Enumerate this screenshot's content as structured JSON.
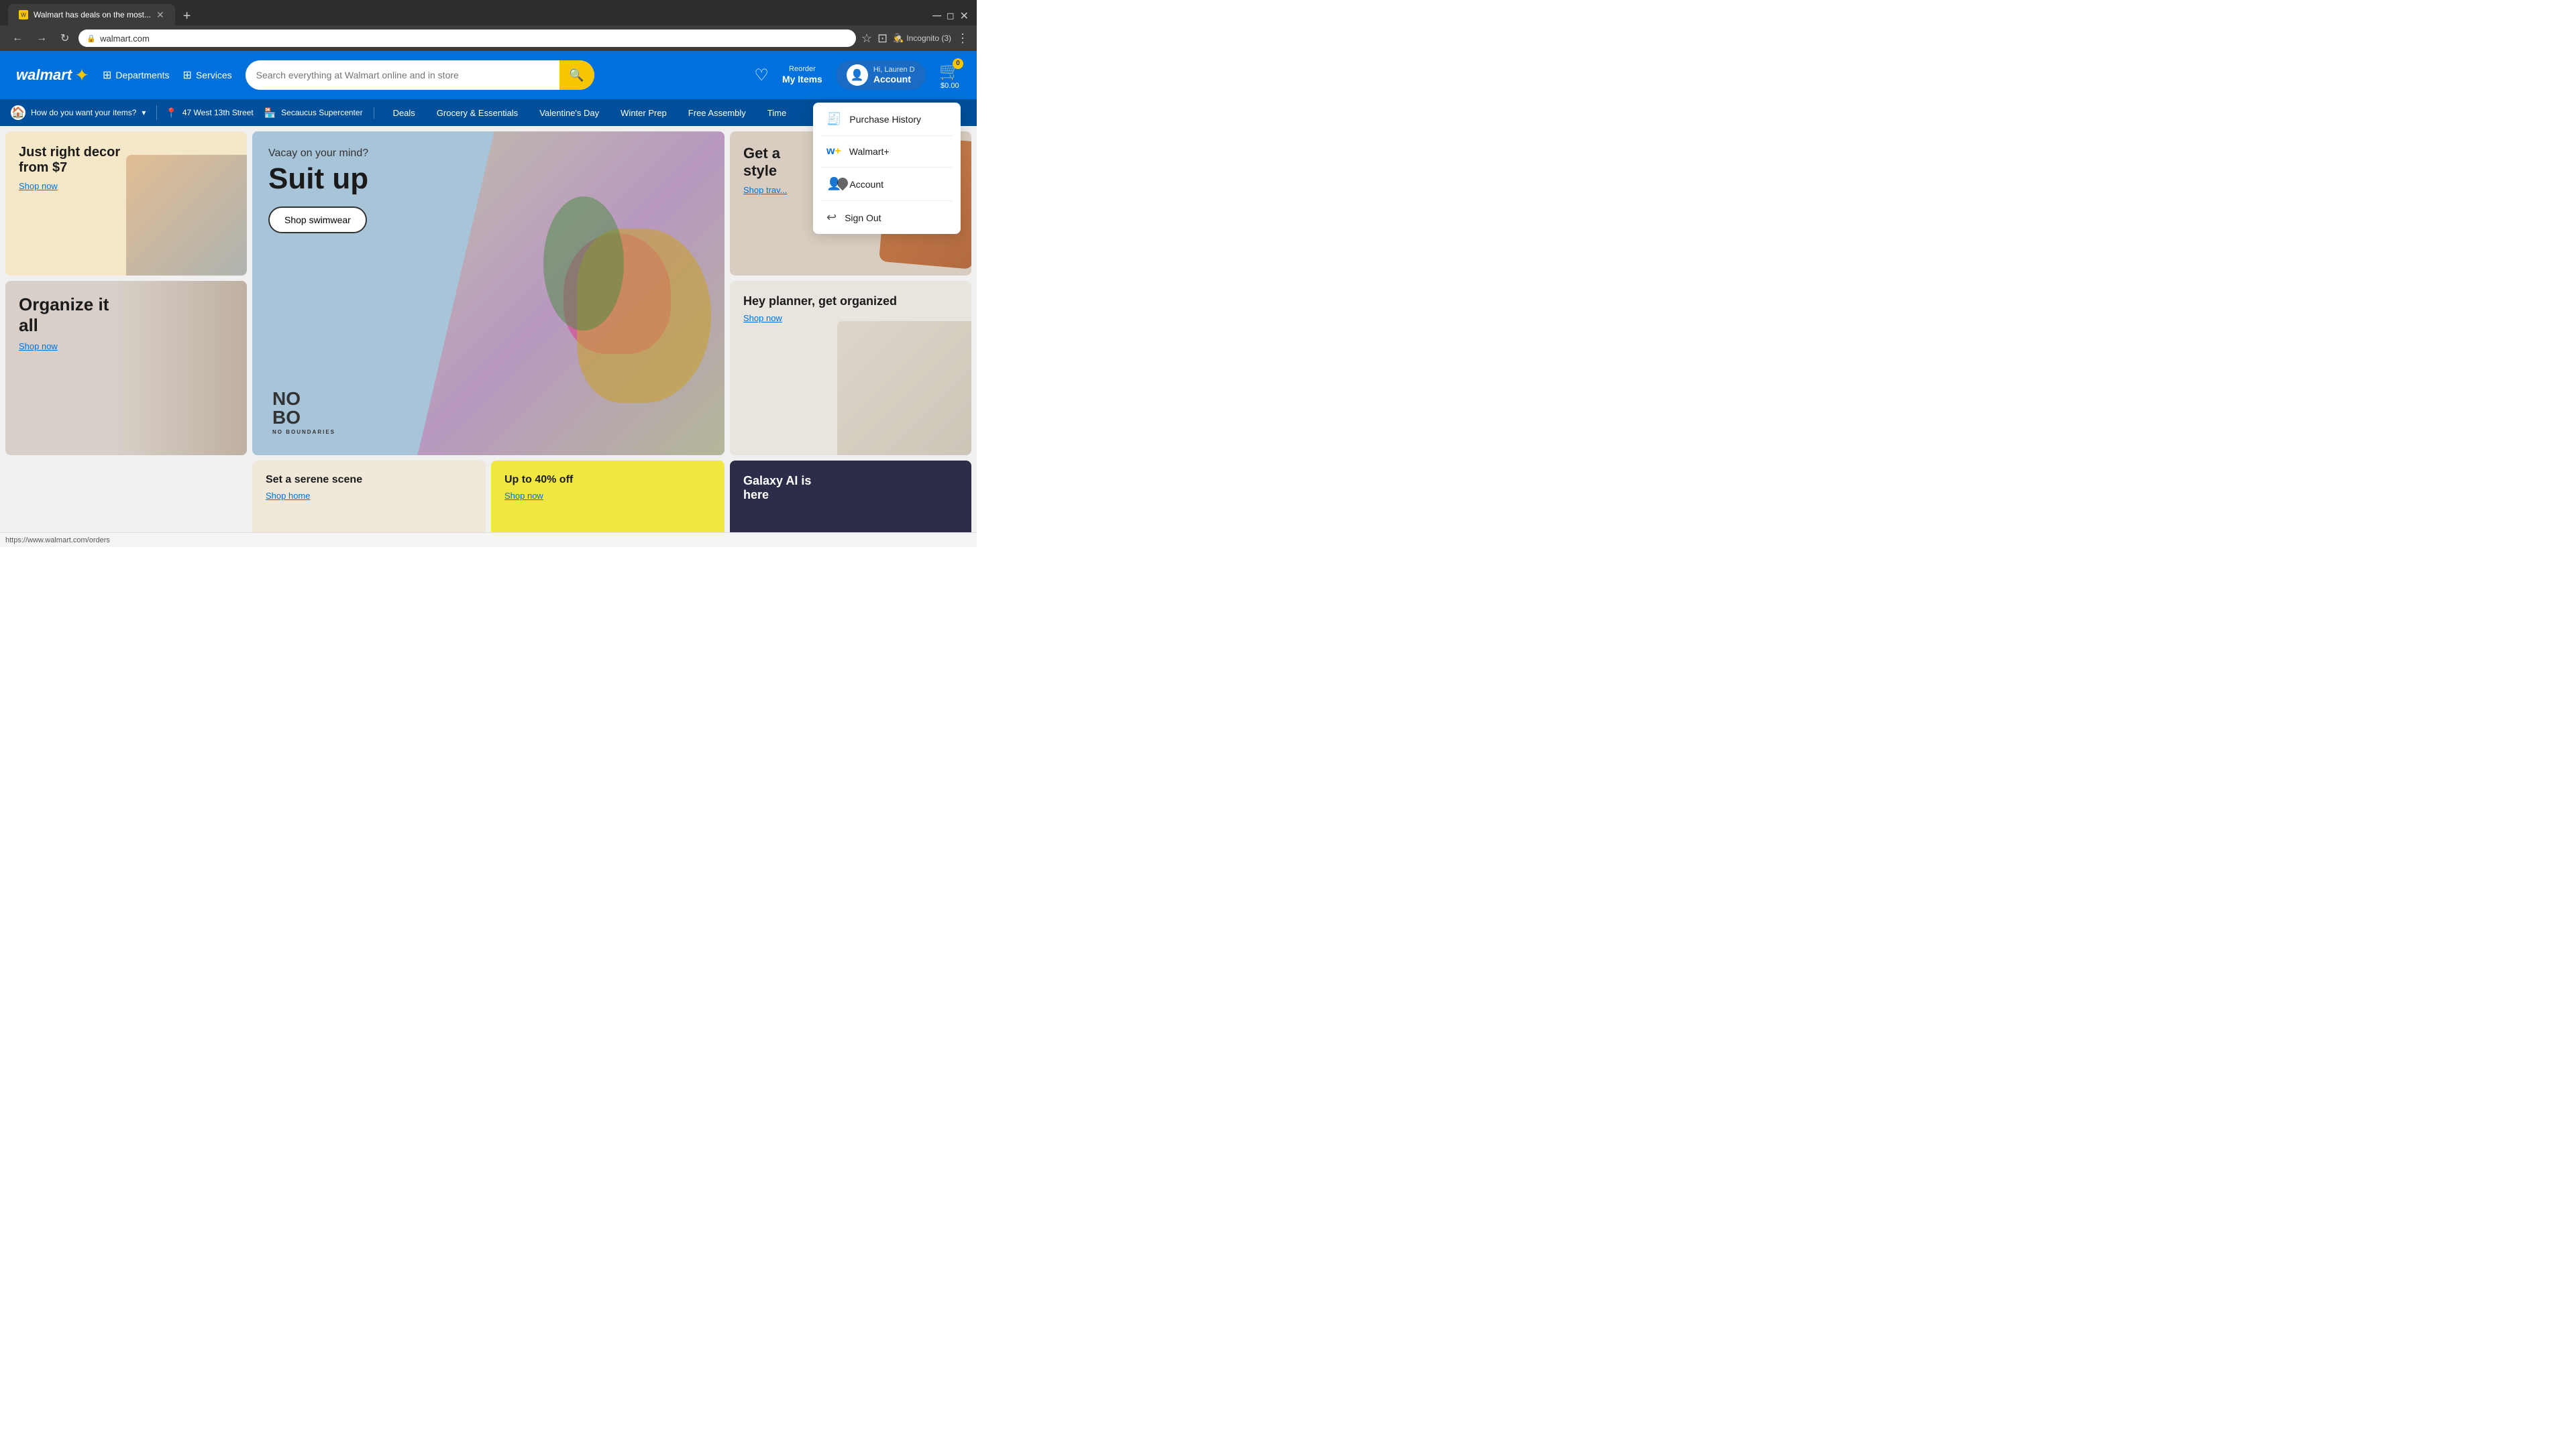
{
  "browser": {
    "tab_title": "Walmart has deals on the most...",
    "favicon_color": "#f7c600",
    "url": "walmart.com",
    "incognito_label": "Incognito (3)"
  },
  "header": {
    "logo_text": "walmart",
    "departments_label": "Departments",
    "services_label": "Services",
    "search_placeholder": "Search everything at Walmart online and in store",
    "reorder_top": "Reorder",
    "reorder_bottom": "My Items",
    "greeting": "Hi, Lauren D",
    "account_label": "Account",
    "cart_price": "$0.00",
    "cart_count": "0",
    "wishlist_icon": "♡"
  },
  "subnav": {
    "delivery_label": "How do you want your items?",
    "address": "47 West 13th Street",
    "store": "Secaucus Supercenter",
    "links": [
      "Deals",
      "Grocery & Essentials",
      "Valentine's Day",
      "Winter Prep",
      "Free Assembly",
      "Time"
    ]
  },
  "cards": {
    "top_left_title": "Just right decor from $7",
    "top_left_link": "Shop now",
    "bottom_left_title1": "Organize it",
    "bottom_left_title2": "all",
    "bottom_left_link": "Shop now",
    "hero_subtitle": "Vacay on your mind?",
    "hero_title": "Suit up",
    "hero_btn": "Shop swimwear",
    "brand_logo": "NO\nBO",
    "brand_sub": "NO BOUNDARIES",
    "right_top_title1": "Get a",
    "right_top_title2": "style",
    "right_top_link": "Shop trav...",
    "right_bottom_title": "Hey planner, get organized",
    "right_bottom_link": "Shop now",
    "bottom_left_card_title": "Set a serene scene",
    "bottom_left_card_link": "Shop home",
    "bottom_mid_title": "Up to 40% off",
    "bottom_mid_link": "Shop now",
    "bottom_right_title": "Galaxy AI is",
    "bottom_right_title2": "here"
  },
  "dropdown": {
    "purchase_history": "Purchase History",
    "walmart_plus": "Walmart+",
    "account": "Account",
    "sign_out": "Sign Out"
  },
  "status": {
    "url": "https://www.walmart.com/orders"
  }
}
